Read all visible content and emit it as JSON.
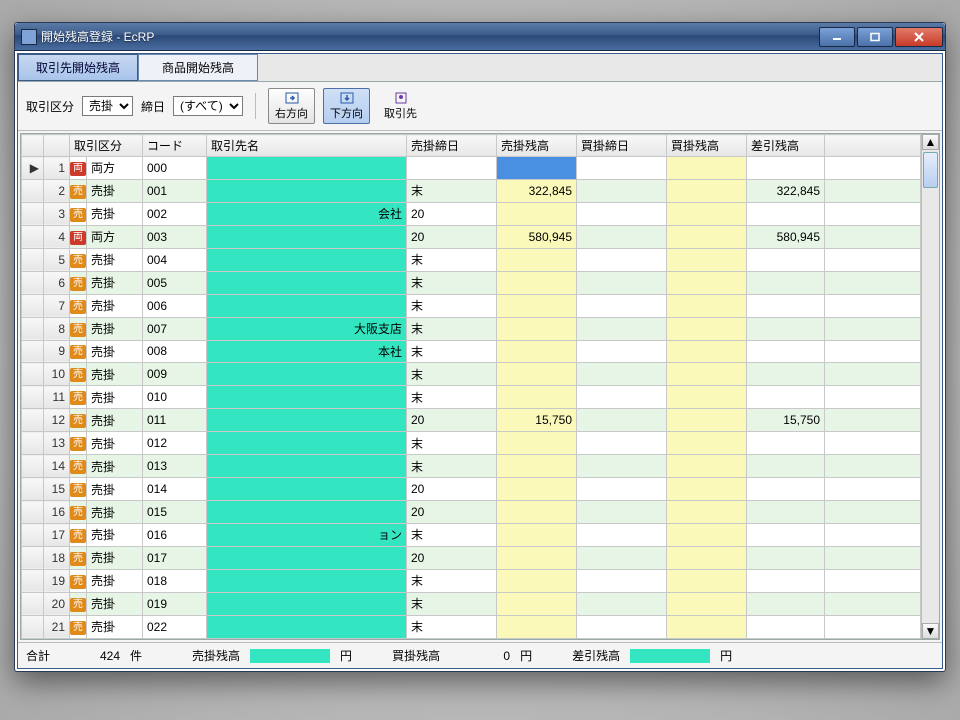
{
  "window": {
    "title": "開始残高登録 - EcRP"
  },
  "tabs": {
    "active": "取引先開始残高",
    "inactive": "商品開始残高"
  },
  "toolbar": {
    "type_label": "取引区分",
    "type_value": "売掛",
    "due_label": "締日",
    "due_value": "(すべて)",
    "btn_right": "右方向",
    "btn_down": "下方向",
    "btn_partner": "取引先"
  },
  "columns": {
    "row": "",
    "sel": "",
    "type": "取引区分",
    "code": "コード",
    "name": "取引先名",
    "ur_due": "売掛締日",
    "ur_bal": "売掛残高",
    "ka_due": "買掛締日",
    "ka_bal": "買掛残高",
    "diff": "差引残高"
  },
  "rows": [
    {
      "n": 1,
      "t": "両方",
      "b": "r",
      "c": "000",
      "nm": "",
      "ud": "",
      "ub": "",
      "kd": "",
      "kb": "",
      "d": "",
      "sel": true
    },
    {
      "n": 2,
      "t": "売掛",
      "b": "u",
      "c": "001",
      "nm": "",
      "ud": "末",
      "ub": "322,845",
      "kd": "",
      "kb": "",
      "d": "322,845"
    },
    {
      "n": 3,
      "t": "売掛",
      "b": "u",
      "c": "002",
      "nm": "会社",
      "ud": "20",
      "ub": "",
      "kd": "",
      "kb": "",
      "d": ""
    },
    {
      "n": 4,
      "t": "両方",
      "b": "r",
      "c": "003",
      "nm": "",
      "ud": "20",
      "ub": "580,945",
      "kd": "",
      "kb": "",
      "d": "580,945"
    },
    {
      "n": 5,
      "t": "売掛",
      "b": "u",
      "c": "004",
      "nm": "",
      "ud": "末",
      "ub": "",
      "kd": "",
      "kb": "",
      "d": ""
    },
    {
      "n": 6,
      "t": "売掛",
      "b": "u",
      "c": "005",
      "nm": "",
      "ud": "末",
      "ub": "",
      "kd": "",
      "kb": "",
      "d": ""
    },
    {
      "n": 7,
      "t": "売掛",
      "b": "u",
      "c": "006",
      "nm": "",
      "ud": "末",
      "ub": "",
      "kd": "",
      "kb": "",
      "d": ""
    },
    {
      "n": 8,
      "t": "売掛",
      "b": "u",
      "c": "007",
      "nm": "大阪支店",
      "ud": "末",
      "ub": "",
      "kd": "",
      "kb": "",
      "d": ""
    },
    {
      "n": 9,
      "t": "売掛",
      "b": "u",
      "c": "008",
      "nm": "本社",
      "ud": "末",
      "ub": "",
      "kd": "",
      "kb": "",
      "d": ""
    },
    {
      "n": 10,
      "t": "売掛",
      "b": "u",
      "c": "009",
      "nm": "",
      "ud": "末",
      "ub": "",
      "kd": "",
      "kb": "",
      "d": ""
    },
    {
      "n": 11,
      "t": "売掛",
      "b": "u",
      "c": "010",
      "nm": "",
      "ud": "末",
      "ub": "",
      "kd": "",
      "kb": "",
      "d": ""
    },
    {
      "n": 12,
      "t": "売掛",
      "b": "u",
      "c": "011",
      "nm": "",
      "ud": "20",
      "ub": "15,750",
      "kd": "",
      "kb": "",
      "d": "15,750"
    },
    {
      "n": 13,
      "t": "売掛",
      "b": "u",
      "c": "012",
      "nm": "",
      "ud": "末",
      "ub": "",
      "kd": "",
      "kb": "",
      "d": ""
    },
    {
      "n": 14,
      "t": "売掛",
      "b": "u",
      "c": "013",
      "nm": "",
      "ud": "末",
      "ub": "",
      "kd": "",
      "kb": "",
      "d": ""
    },
    {
      "n": 15,
      "t": "売掛",
      "b": "u",
      "c": "014",
      "nm": "",
      "ud": "20",
      "ub": "",
      "kd": "",
      "kb": "",
      "d": ""
    },
    {
      "n": 16,
      "t": "売掛",
      "b": "u",
      "c": "015",
      "nm": "",
      "ud": "20",
      "ub": "",
      "kd": "",
      "kb": "",
      "d": ""
    },
    {
      "n": 17,
      "t": "売掛",
      "b": "u",
      "c": "016",
      "nm": "ョン",
      "ud": "末",
      "ub": "",
      "kd": "",
      "kb": "",
      "d": ""
    },
    {
      "n": 18,
      "t": "売掛",
      "b": "u",
      "c": "017",
      "nm": "",
      "ud": "20",
      "ub": "",
      "kd": "",
      "kb": "",
      "d": ""
    },
    {
      "n": 19,
      "t": "売掛",
      "b": "u",
      "c": "018",
      "nm": "",
      "ud": "末",
      "ub": "",
      "kd": "",
      "kb": "",
      "d": ""
    },
    {
      "n": 20,
      "t": "売掛",
      "b": "u",
      "c": "019",
      "nm": "",
      "ud": "末",
      "ub": "",
      "kd": "",
      "kb": "",
      "d": ""
    },
    {
      "n": 21,
      "t": "売掛",
      "b": "u",
      "c": "022",
      "nm": "",
      "ud": "末",
      "ub": "",
      "kb": "",
      "kd": "",
      "d": ""
    }
  ],
  "footer": {
    "total_label": "合計",
    "count": "424",
    "count_suffix": "件",
    "ur_label": "売掛残高",
    "ur_suffix": "円",
    "ka_label": "買掛残高",
    "ka_value": "0",
    "ka_suffix": "円",
    "diff_label": "差引残高",
    "diff_suffix": "円"
  },
  "badge_chars": {
    "u": "売",
    "r": "両"
  }
}
